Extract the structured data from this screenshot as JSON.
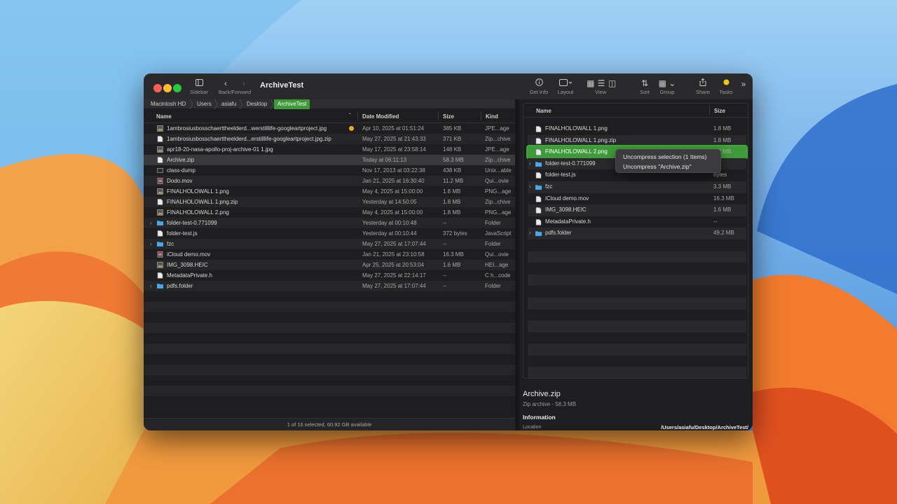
{
  "window": {
    "title": "ArchiveTest",
    "toolbar": {
      "sidebar_label": "Sidebar",
      "backforward_label": "Back/Forward",
      "getinfo_label": "Get Info",
      "layout_label": "Layout",
      "view_label": "View",
      "sort_label": "Sort",
      "group_label": "Group",
      "share_label": "Share",
      "tasks_label": "Tasks",
      "icons": {
        "sidebar": "sidebar-icon",
        "back": "chevron-left-icon",
        "forward": "chevron-right-icon",
        "getinfo": "info-icon",
        "layout": "layout-icon",
        "view_grid": "grid-icon",
        "view_list": "list-icon",
        "view_columns": "columns-icon",
        "sort": "sort-icon",
        "group": "group-icon",
        "share": "share-icon",
        "tasks": "sun-icon",
        "more": "chevron-double-right-icon"
      }
    }
  },
  "pathbar": {
    "crumbs": [
      "Macintosh HD",
      "Users",
      "asiafu",
      "Desktop",
      "ArchiveTest"
    ]
  },
  "left": {
    "columns": {
      "name": "Name",
      "date": "Date Modified",
      "size": "Size",
      "kind": "Kind"
    },
    "rows": [
      {
        "name": "1ambrosiusbosschaerttheelderd...werstilllife-googleartproject.jpg",
        "date": "Apr 10, 2025 at 01:51:24",
        "size": "385 KB",
        "kind": "JPE...age",
        "icon": "image-file-icon",
        "tag": true
      },
      {
        "name": "1ambrosiusbosschaerttheelderd...erstilllife-googleartproject.jpg.zip",
        "date": "May 27, 2025 at 21:43:33",
        "size": "371 KB",
        "kind": "Zip...chive",
        "icon": "document-icon"
      },
      {
        "name": "apr18-20-nasa-apollo-proj-archive-01 1.jpg",
        "date": "May 17, 2025 at 23:58:14",
        "size": "148 KB",
        "kind": "JPE...age",
        "icon": "image-file-icon"
      },
      {
        "name": "Archive.zip",
        "date": "Today at 06:11:13",
        "size": "58.3 MB",
        "kind": "Zip...chive",
        "icon": "document-icon",
        "selected": true
      },
      {
        "name": "class-dump",
        "date": "Nov 17, 2013 at 03:22:38",
        "size": "438 KB",
        "kind": "Unix...able",
        "icon": "executable-icon"
      },
      {
        "name": "Dodo.mov",
        "date": "Jan 21, 2025 at 16:30:40",
        "size": "11.2 MB",
        "kind": "Qui...ovie",
        "icon": "movie-file-icon"
      },
      {
        "name": "FINALHOLOWALL 1.png",
        "date": "May 4, 2025 at 15:00:00",
        "size": "1.8 MB",
        "kind": "PNG...age",
        "icon": "image-file-icon"
      },
      {
        "name": "FINALHOLOWALL 1.png.zip",
        "date": "Yesterday at 14:50:05",
        "size": "1.8 MB",
        "kind": "Zip...chive",
        "icon": "document-icon"
      },
      {
        "name": "FINALHOLOWALL 2.png",
        "date": "May 4, 2025 at 15:00:00",
        "size": "1.8 MB",
        "kind": "PNG...age",
        "icon": "image-file-icon"
      },
      {
        "name": "folder-test-0.771099",
        "date": "Yesterday at 00:10:48",
        "size": "--",
        "kind": "Folder",
        "icon": "folder-icon",
        "folder": true
      },
      {
        "name": "folder-test.js",
        "date": "Yesterday at 00:10:44",
        "size": "372 bytes",
        "kind": "JavaScript",
        "icon": "document-icon"
      },
      {
        "name": "fzc",
        "date": "May 27, 2025 at 17:07:44",
        "size": "--",
        "kind": "Folder",
        "icon": "folder-icon",
        "folder": true
      },
      {
        "name": "iCloud demo.mov",
        "date": "Jan 21, 2025 at 23:10:58",
        "size": "16.3 MB",
        "kind": "Qui...ovie",
        "icon": "movie-file-icon"
      },
      {
        "name": "IMG_3098.HEIC",
        "date": "Apr 25, 2025 at 20:53:04",
        "size": "1.6 MB",
        "kind": "HEI...age",
        "icon": "image-file-icon"
      },
      {
        "name": "MetadataPrivate.h",
        "date": "May 27, 2025 at 22:14:17",
        "size": "--",
        "kind": "C h...code",
        "icon": "document-icon"
      },
      {
        "name": "pdfs.folder",
        "date": "May 27, 2025 at 17:07:44",
        "size": "--",
        "kind": "Folder",
        "icon": "folder-icon",
        "folder": true
      }
    ],
    "status": "1 of 16 selected, 60.92 GB available"
  },
  "right": {
    "columns": {
      "name": "Name",
      "size": "Size"
    },
    "rows": [
      {
        "name": "FINALHOLOWALL 1.png",
        "size": "1.8 MB",
        "icon": "document-icon"
      },
      {
        "name": "FINALHOLOWALL 1.png.zip",
        "size": "1.8 MB",
        "icon": "document-icon"
      },
      {
        "name": "FINALHOLOWALL 2.png",
        "size": "1.8 MB",
        "icon": "document-icon",
        "drop": true
      },
      {
        "name": "folder-test-0.771099",
        "size": "",
        "icon": "folder-icon",
        "folder": true
      },
      {
        "name": "folder-test.js",
        "size": "bytes",
        "icon": "document-icon"
      },
      {
        "name": "fzc",
        "size": "3.3 MB",
        "icon": "folder-icon",
        "folder": true
      },
      {
        "name": "iCloud demo.mov",
        "size": "16.3 MB",
        "icon": "document-icon"
      },
      {
        "name": "IMG_3098.HEIC",
        "size": "1.6 MB",
        "icon": "document-icon"
      },
      {
        "name": "MetadataPrivate.h",
        "size": "--",
        "icon": "document-icon"
      },
      {
        "name": "pdfs.folder",
        "size": "49.2 MB",
        "icon": "folder-icon",
        "folder": true
      }
    ],
    "info": {
      "title": "Archive.zip",
      "subtitle": "Zip archive - 58.3 MB",
      "heading": "Information",
      "location_label": "Location",
      "location_value": "/Users/asiafu/Desktop/ArchiveTest/"
    }
  },
  "context_menu": {
    "items": [
      "Uncompress selection (1 Items)",
      "Uncompress \"Archive.zip\""
    ]
  },
  "colors": {
    "accent": "#3f9b3a",
    "tag_orange": "#f5a623",
    "folder_blue": "#4aa8e8"
  }
}
